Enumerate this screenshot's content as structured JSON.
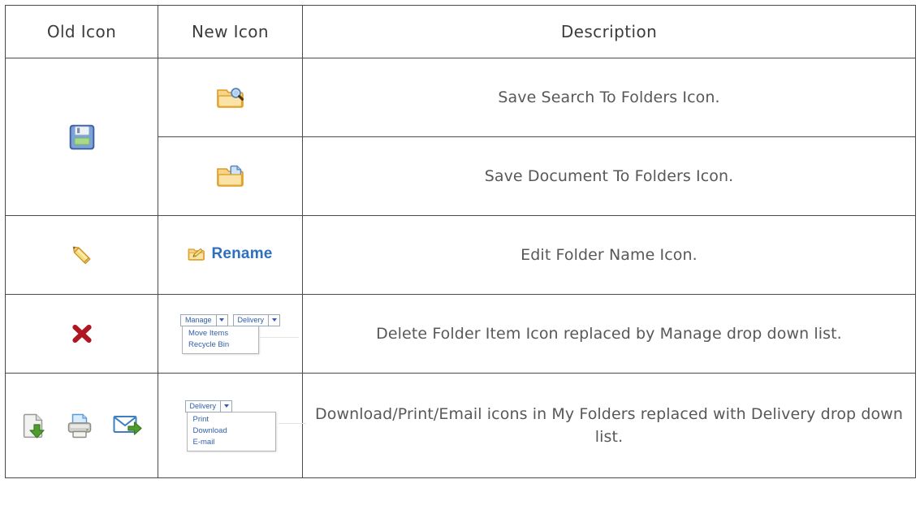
{
  "table": {
    "headers": [
      {
        "label": "Old Icon",
        "name": "header-old-icon"
      },
      {
        "label": "New Icon",
        "name": "header-new-icon"
      },
      {
        "label": "Description",
        "name": "header-description"
      }
    ],
    "rows": [
      {
        "old_icon": "floppy-disk-save-icon",
        "new_icon": "folder-with-magnifier-icon",
        "description": "Save Search To Folders Icon."
      },
      {
        "old_icon": "floppy-disk-save-icon",
        "new_icon": "folder-with-document-icon",
        "description": "Save Document To Folders Icon."
      },
      {
        "old_icon": "pencil-edit-icon",
        "new_icon": "rename-folder-link",
        "new_icon_label": "Rename",
        "description": "Edit Folder Name Icon."
      },
      {
        "old_icon": "red-x-delete-icon",
        "new_icon": "manage-dropdown",
        "description": "Delete Folder Item Icon replaced by Manage drop down list."
      },
      {
        "old_icon": "download-print-email-icons",
        "new_icon": "delivery-dropdown",
        "description": "Download/Print/Email icons in My Folders replaced with Delivery drop down list."
      }
    ]
  },
  "dropdowns": {
    "manage": {
      "button_label": "Manage",
      "items": [
        "Move Items",
        "Recycle Bin"
      ]
    },
    "delivery_inline": {
      "button_label": "Delivery"
    },
    "delivery": {
      "button_label": "Delivery",
      "items": [
        "Print",
        "Download",
        "E-mail"
      ]
    }
  },
  "icons": {
    "save": "floppy-disk-icon",
    "pencil": "pencil-icon",
    "delete": "red-x-icon",
    "download": "document-download-icon",
    "print": "printer-icon",
    "email": "envelope-forward-icon",
    "folder_search": "folder-search-icon",
    "folder_document": "folder-document-icon",
    "folder_edit": "folder-pencil-icon"
  },
  "colors": {
    "border": "#4a4a4a",
    "text": "#58585a",
    "link": "#2f6fc0",
    "folder_orange": "#f0a830",
    "delete_red": "#b01622",
    "accent_green": "#6aa84f"
  }
}
